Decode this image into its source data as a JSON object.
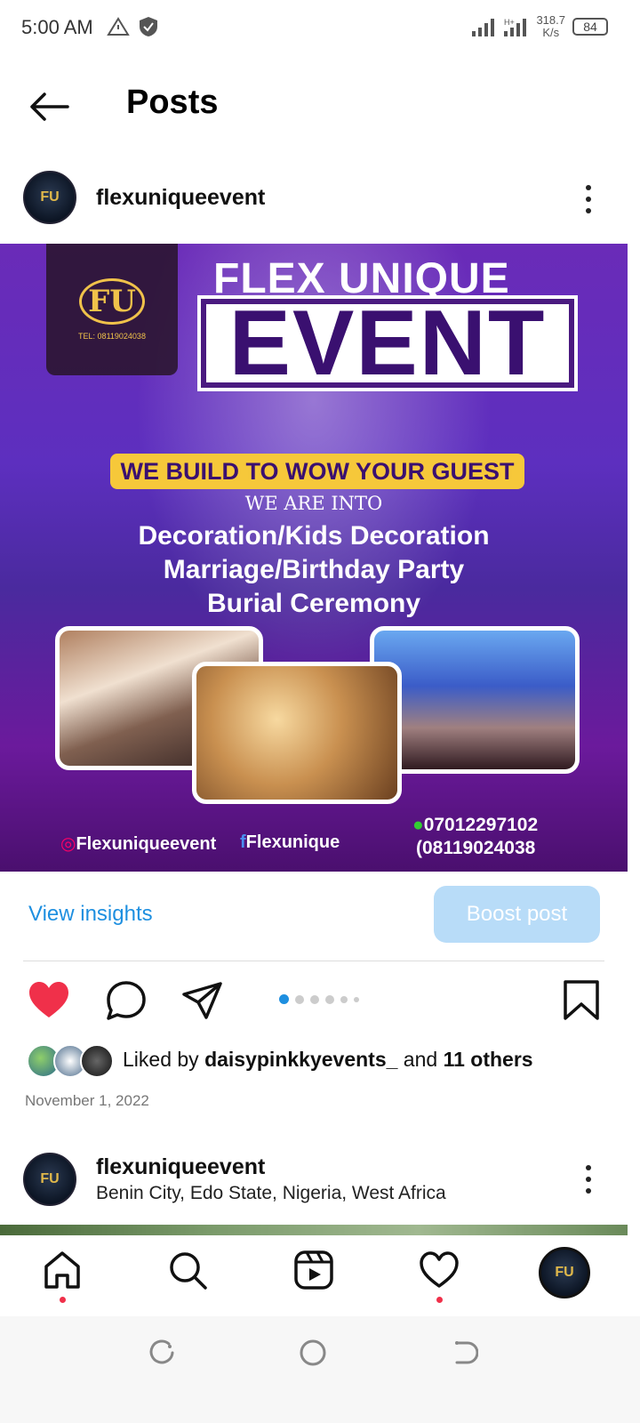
{
  "status_bar": {
    "time": "5:00 AM",
    "network_speed_value": "318.7",
    "network_speed_unit": "K/s",
    "battery": "84"
  },
  "header": {
    "title": "Posts",
    "back_icon": "arrow-left-icon"
  },
  "post": {
    "username": "flexuniqueevent",
    "avatar_text": "FU",
    "image": {
      "logo_text": "FU",
      "logo_tel": "TEL: 08119024038",
      "headline": "FLEX UNIQUE",
      "headline_big": "EVENT",
      "banner": "WE BUILD TO WOW YOUR GUEST",
      "we_are_into": "WE ARE INTO",
      "services": [
        "Decoration/Kids Decoration",
        "Marriage/Birthday Party",
        "Burial Ceremony"
      ],
      "instagram_handle": "Flexuniqueevent",
      "facebook_handle": "Flexunique",
      "phone_1": "07012297102",
      "phone_2": "08119024038"
    },
    "view_insights": "View insights",
    "boost_post": "Boost post",
    "carousel": {
      "count": 6,
      "active_index": 0
    },
    "liked_by_prefix": "Liked by",
    "liked_by_user": "daisypinkkyevents_",
    "liked_by_and": "and",
    "liked_by_others": "11 others",
    "date": "November 1, 2022"
  },
  "next_post": {
    "username": "flexuniqueevent",
    "location": "Benin City, Edo State, Nigeria, West Africa",
    "avatar_text": "FU"
  },
  "colors": {
    "accent_blue": "#1e8fe0",
    "like_red": "#f0304a",
    "boost_disabled": "#b8dcf8"
  },
  "bottom_nav": {
    "items": [
      "home-icon",
      "search-icon",
      "reels-icon",
      "activity-heart-icon",
      "profile-avatar"
    ]
  }
}
